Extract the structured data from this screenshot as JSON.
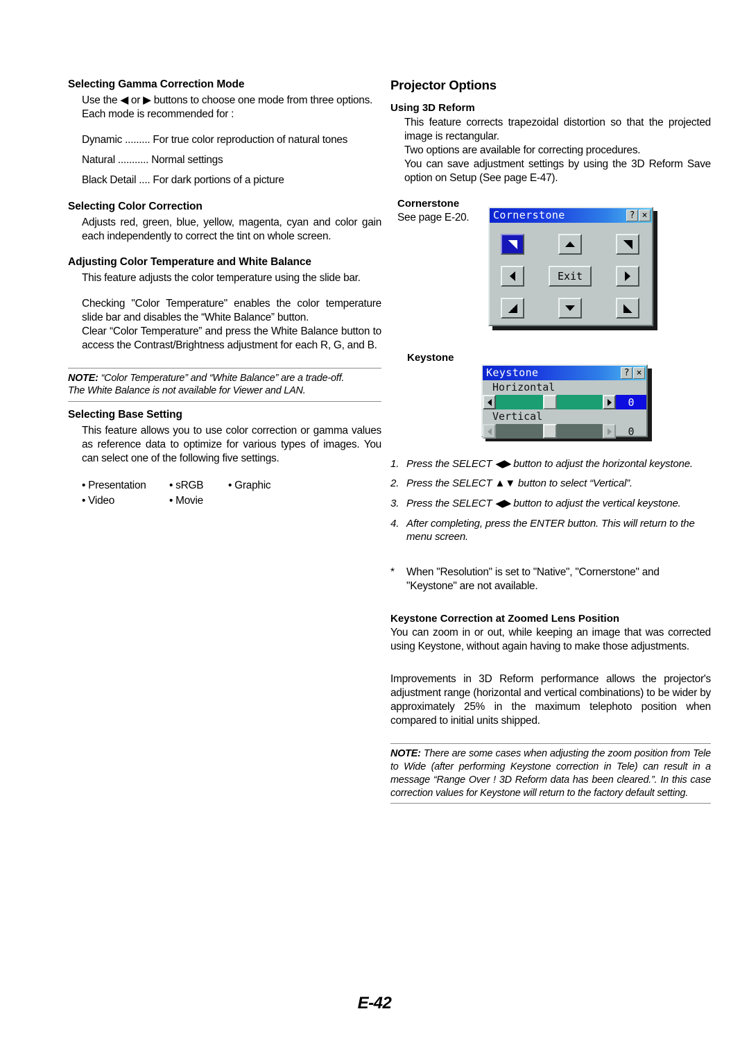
{
  "page": {
    "footer": "E-42"
  },
  "left_column": {
    "gamma": {
      "title": "Selecting Gamma Correction Mode",
      "body": "Use the ◀ or ▶ buttons to choose one mode from three options. Each mode is recommended for :",
      "modes": [
        {
          "name": "Dynamic .........",
          "desc": "For true color reproduction of natural tones"
        },
        {
          "name": "Natural ...........",
          "desc": "Normal settings"
        },
        {
          "name": "Black Detail ....",
          "desc": "For dark portions of a picture"
        }
      ]
    },
    "color_correction": {
      "title": "Selecting Color Correction",
      "body": "Adjusts red, green, blue, yellow, magenta, cyan and color gain each independently to correct the tint on whole screen."
    },
    "color_temp": {
      "title": "Adjusting Color Temperature and White Balance",
      "body1": "This feature adjusts the color temperature using the slide bar.",
      "body2": "Checking \"Color Temperature\" enables the color temperature slide bar and disables the “White Balance” button.",
      "body3": "Clear “Color Temperature” and press the White Balance button to access the Contrast/Brightness adjustment for each R, G, and B."
    },
    "note1": {
      "label": "NOTE:",
      "line1": " “Color Temperature” and “White Balance” are a trade-off.",
      "line2": "The White Balance is not available for Viewer and LAN."
    },
    "base_setting": {
      "title": "Selecting Base Setting",
      "body": "This feature allows you to use color correction or gamma values as reference data to optimize for various types of images. You can select one of the following five settings.",
      "options_row1": [
        "• Presentation",
        "• sRGB",
        "• Graphic"
      ],
      "options_row2": [
        "• Video",
        "• Movie",
        ""
      ]
    }
  },
  "right_column": {
    "heading": "Projector Options",
    "reform": {
      "title": "Using 3D Reform",
      "body1": "This feature corrects trapezoidal distortion so that the projected image is rectangular.",
      "body2": "Two options are available for correcting procedures.",
      "body3": "You can save adjustment settings by using the 3D Reform Save option on Setup (See page E-47)."
    },
    "cornerstone": {
      "title": "Cornerstone",
      "body": "See page E-20."
    },
    "keystone_label": "Keystone",
    "steps": [
      {
        "n": "1.",
        "text": "Press the SELECT ◀▶ button to adjust the horizontal keystone."
      },
      {
        "n": "2.",
        "text": "Press the SELECT ▲▼ button to select “Vertical”."
      },
      {
        "n": "3.",
        "text": "Press the SELECT ◀▶ button to adjust the vertical keystone."
      },
      {
        "n": "4.",
        "text": "After completing, press the ENTER button. This will return to the menu screen."
      }
    ],
    "star_note": {
      "marker": "*",
      "text": "When \"Resolution\" is set to \"Native\", \"Cornerstone\" and \"Keystone\" are not available."
    },
    "zoomed_lens": {
      "title": "Keystone Correction at Zoomed Lens Position",
      "body": "You can zoom in or out, while keeping an image that was corrected using Keystone, without again having to make those adjustments."
    },
    "improvements": "Improvements in 3D Reform performance allows the projector's adjustment range (horizontal and vertical combinations) to be wider by approximately 25% in the maximum telephoto position when compared to initial units shipped.",
    "note2": {
      "label": "NOTE:",
      "line1": " There are some cases when adjusting the zoom position from Tele to Wide (after performing Keystone correction in Tele) can result in a message “Range Over ! 3D Reform data has been cleared.”. In this case correction values for Keystone will return to the factory default setting."
    }
  },
  "osd": {
    "cornerstone_dialog": {
      "title": "Cornerstone",
      "help_button": "?",
      "close_button": "×",
      "exit_button": "Exit",
      "selected_corner": "top-left"
    },
    "keystone_dialog": {
      "title": "Keystone",
      "help_button": "?",
      "close_button": "×",
      "horizontal_label": "Horizontal",
      "horizontal_value": "0",
      "vertical_label": "Vertical",
      "vertical_value": "0"
    },
    "colors": {
      "titlebar_start": "#0b24cf",
      "titlebar_end": "#56c6f2",
      "dialog_face": "#bfc8c6",
      "active_track": "#1a9e72",
      "inactive_track": "#5d6d68",
      "value_box": "#0d0de0",
      "selected_corner": "#1515b8"
    }
  }
}
